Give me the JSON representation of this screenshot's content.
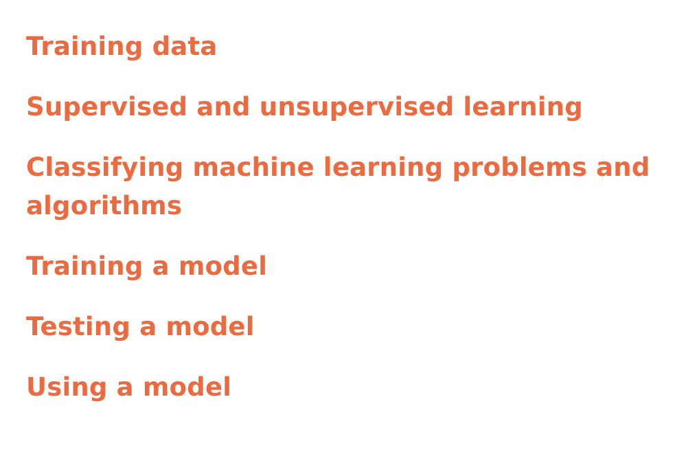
{
  "topics": {
    "items": [
      {
        "label": "Training data"
      },
      {
        "label": "Supervised and unsupervised learning"
      },
      {
        "label": "Classifying machine learning problems and algorithms"
      },
      {
        "label": "Training a model"
      },
      {
        "label": "Testing a model"
      },
      {
        "label": "Using a model"
      }
    ],
    "color": "#ec6a3f"
  }
}
